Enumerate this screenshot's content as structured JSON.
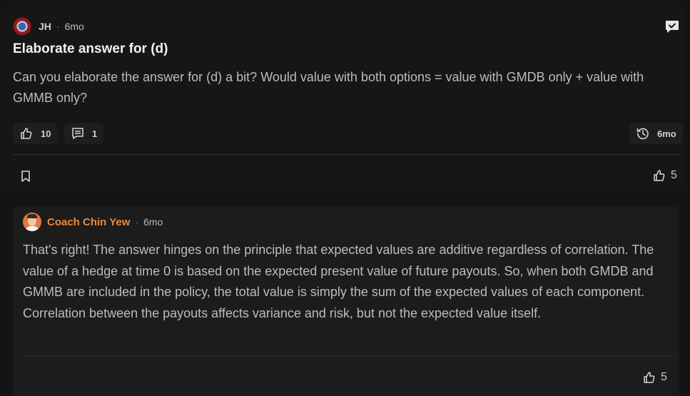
{
  "post": {
    "author": "JH",
    "separator": "·",
    "age": "6mo",
    "title": "Elaborate answer for (d)",
    "body": "Can you elaborate the answer for (d) a bit? Would value with both options = value with GMDB only + value with GMMB only?",
    "likes": "10",
    "comments": "1",
    "last_activity": "6mo",
    "footer_likes": "5",
    "icons": [
      "chat-check-icon",
      "thumbs-up-icon",
      "comment-icon",
      "history-icon",
      "bookmark-icon"
    ]
  },
  "reply": {
    "author": "Coach Chin Yew",
    "separator": "·",
    "age": "6mo",
    "body": "That's right! The answer hinges on the principle that expected values are additive regardless of correlation. The value of a hedge at time 0 is based on the expected present value of future payouts. So, when both GMDB and GMMB are included in the policy, the total value is simply the sum of the expected values of each component. Correlation between the payouts affects variance and risk, but not the expected value itself.",
    "likes": "5",
    "author_color": "#e8893f"
  }
}
